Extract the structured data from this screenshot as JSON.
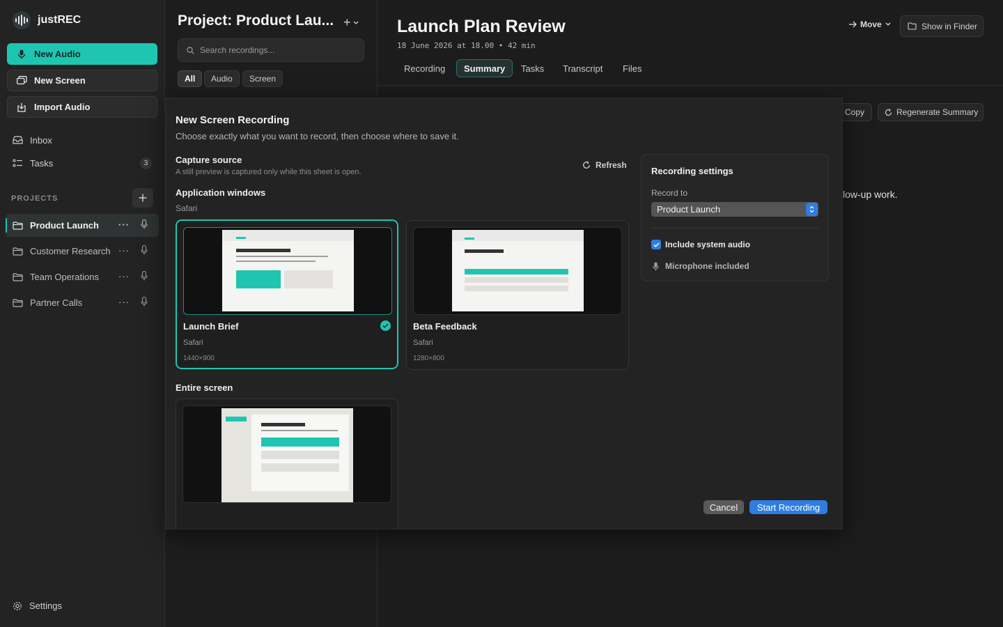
{
  "app": {
    "name": "justREC"
  },
  "sidebar": {
    "new_audio_label": "New Audio",
    "new_screen_label": "New Screen",
    "import_audio_label": "Import Audio",
    "nav": [
      {
        "label": "Inbox",
        "icon": "inbox-icon"
      },
      {
        "label": "Tasks",
        "icon": "tasks-icon",
        "badge": "3"
      }
    ],
    "projects_label": "PROJECTS",
    "projects": [
      {
        "label": "Product Launch",
        "active": true
      },
      {
        "label": "Customer Research"
      },
      {
        "label": "Team Operations"
      },
      {
        "label": "Partner Calls"
      }
    ],
    "more_glyph": "···",
    "settings_label": "Settings"
  },
  "project_pane": {
    "title": "Project: Product Lau...",
    "plus_glyph": "+",
    "search_placeholder": "Search recordings...",
    "filters": [
      {
        "label": "All",
        "active": true
      },
      {
        "label": "Audio"
      },
      {
        "label": "Screen"
      }
    ]
  },
  "detail": {
    "title": "Launch Plan Review",
    "meta": "18 June 2026 at 18.00 • 42 min",
    "move_label": "Move",
    "show_in_finder_label": "Show in Finder",
    "tabs": [
      {
        "label": "Recording"
      },
      {
        "label": "Summary",
        "active": true
      },
      {
        "label": "Tasks"
      },
      {
        "label": "Transcript"
      },
      {
        "label": "Files"
      }
    ],
    "copy_label": "Copy",
    "regenerate_label": "Regenerate Summary",
    "body_fragment": "low-up work."
  },
  "sheet": {
    "title": "New Screen Recording",
    "subtitle": "Choose exactly what you want to record, then choose where to save it.",
    "capture_source_title": "Capture source",
    "capture_source_sub": "A still preview is captured only while this sheet is open.",
    "refresh_label": "Refresh",
    "app_windows_title": "Application windows",
    "app_windows_group": "Safari",
    "windows": [
      {
        "name": "Launch Brief",
        "app": "Safari",
        "dimensions": "1440×900",
        "selected": true
      },
      {
        "name": "Beta Feedback",
        "app": "Safari",
        "dimensions": "1280×800",
        "selected": false
      }
    ],
    "entire_screen_title": "Entire screen",
    "settings": {
      "title": "Recording settings",
      "record_to_label": "Record to",
      "record_to_value": "Product Launch",
      "include_system_audio_label": "Include system audio",
      "include_system_audio": true,
      "microphone_label": "Microphone included"
    },
    "cancel_label": "Cancel",
    "start_label": "Start Recording"
  },
  "colors": {
    "accent": "#1ec6b1",
    "blue": "#2f7de1",
    "background": "#1b1b1b"
  }
}
